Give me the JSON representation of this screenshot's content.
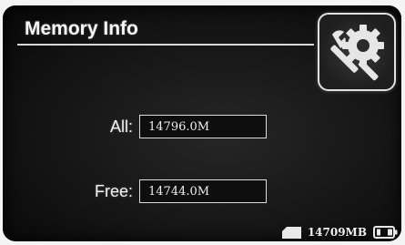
{
  "header": {
    "title": "Memory Info"
  },
  "icons": {
    "settings": "gear-wrench-icon",
    "storage": "sd-card-icon",
    "battery": "battery-icon"
  },
  "fields": {
    "all": {
      "label": "All:",
      "value": "14796.0M"
    },
    "free": {
      "label": "Free:",
      "value": "14744.0M"
    }
  },
  "status": {
    "storage_text": "14709MB"
  },
  "colors": {
    "screen_background": "#1a1a1a",
    "text": "#f2f2f2",
    "border": "#dcdcdc"
  }
}
